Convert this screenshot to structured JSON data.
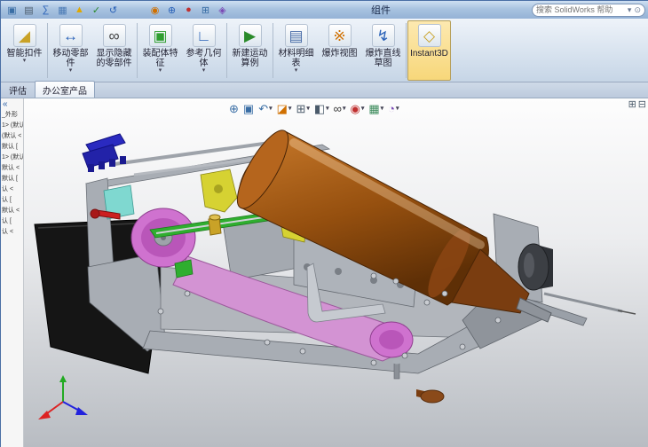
{
  "titlebar": {
    "title_fragment": "组件",
    "search_placeholder": "搜索 SolidWorks 帮助",
    "icons": [
      {
        "name": "window-icon",
        "glyph": "▣",
        "color": "#3a6ea5"
      },
      {
        "name": "print-icon",
        "glyph": "▤",
        "color": "#4a5a6a"
      },
      {
        "name": "sum-icon",
        "glyph": "∑",
        "color": "#2a62b8"
      },
      {
        "name": "table-icon",
        "glyph": "▦",
        "color": "#4a7ab5"
      },
      {
        "name": "warning-icon",
        "glyph": "▲",
        "color": "#e0a800"
      },
      {
        "name": "check-icon",
        "glyph": "✓",
        "color": "#2a8a2a"
      },
      {
        "name": "rotate-icon",
        "glyph": "↺",
        "color": "#2a62b8"
      },
      {
        "name": "target-icon",
        "glyph": "◉",
        "color": "#d07000"
      },
      {
        "name": "add-icon",
        "glyph": "⊕",
        "color": "#2a62b8"
      },
      {
        "name": "sphere-icon",
        "glyph": "●",
        "color": "#c03030"
      },
      {
        "name": "grid-icon",
        "glyph": "⊞",
        "color": "#3a6ea5"
      },
      {
        "name": "gem-icon",
        "glyph": "◈",
        "color": "#7a4ab5"
      }
    ]
  },
  "ui": {
    "dropdown_arrow": "▾",
    "collapse_glyph": "«"
  },
  "ribbon": {
    "items": [
      {
        "label": "智能扣件",
        "glyph": "◢",
        "color": "#c9a227"
      },
      {
        "label": "移动零部件",
        "glyph": "↔",
        "color": "#2a62b8"
      },
      {
        "label": "显示隐藏的零部件",
        "glyph": "∞",
        "color": "#444444"
      },
      {
        "label": "装配体特征",
        "glyph": "▣",
        "color": "#2f9e2f"
      },
      {
        "label": "参考几何体",
        "glyph": "∟",
        "color": "#2a62b8"
      },
      {
        "label": "新建运动算例",
        "glyph": "▶",
        "color": "#2a8a2a"
      },
      {
        "label": "材料明细表",
        "glyph": "▤",
        "color": "#4a6da8"
      },
      {
        "label": "爆炸视图",
        "glyph": "※",
        "color": "#d07000"
      },
      {
        "label": "爆炸直线草图",
        "glyph": "↯",
        "color": "#2a62b8"
      },
      {
        "label": "Instant3D",
        "glyph": "◇",
        "color": "#c9a227"
      }
    ]
  },
  "tabs": [
    {
      "label": "评估"
    },
    {
      "label": "办公室产品"
    }
  ],
  "hud": {
    "items": [
      {
        "name": "zoom-fit",
        "glyph": "⊕",
        "color": "#3a6ea5",
        "arrow": false
      },
      {
        "name": "zoom-area",
        "glyph": "▣",
        "color": "#3a6ea5",
        "arrow": false
      },
      {
        "name": "previous-view",
        "glyph": "↶",
        "color": "#3a6ea5",
        "arrow": true
      },
      {
        "name": "section-view",
        "glyph": "◪",
        "color": "#d07000",
        "arrow": true
      },
      {
        "name": "view-orientation",
        "glyph": "⊞",
        "color": "#4a5a6a",
        "arrow": true
      },
      {
        "name": "display-style",
        "glyph": "◧",
        "color": "#4a5a6a",
        "arrow": true
      },
      {
        "name": "hide-show-items",
        "glyph": "∞",
        "color": "#333333",
        "arrow": true
      },
      {
        "name": "edit-appearance",
        "glyph": "◉",
        "color": "#c03030",
        "arrow": true
      },
      {
        "name": "apply-scene",
        "glyph": "▦",
        "color": "#3a8a5a",
        "arrow": true
      },
      {
        "name": "view-settings",
        "glyph": "◔",
        "color": "#7a4ab5",
        "arrow": true
      }
    ],
    "pane_icons": [
      {
        "glyph": "⊞"
      },
      {
        "glyph": "⊟"
      }
    ]
  },
  "tree": {
    "items": [
      "_外形",
      "1> (默认",
      "(默认 <",
      "默认 [",
      "1> (默认",
      "默认 <",
      "默认 [",
      "认 <",
      "认 [",
      "默认 <",
      "认 [",
      "认 <"
    ]
  },
  "model": {
    "colors": {
      "frame": "#a8adb4",
      "frame_light": "#c6cad0",
      "cylinder": "#a0571a",
      "cylinder_dark": "#7a3d10",
      "pulley": "#cf72cf",
      "pulley_inner": "#b956b9",
      "belt": "#d393d3",
      "rail_green": "#2fae2f",
      "bracket_yellow": "#d6d232",
      "block_teal": "#7fd8d0",
      "bracket_blue": "#2a2ac0",
      "plate_black": "#151515",
      "screw_red": "#cc2020",
      "brass": "#c9a227",
      "triad_x": "#dd2222",
      "triad_y": "#22aa22",
      "triad_z": "#2222dd"
    }
  }
}
